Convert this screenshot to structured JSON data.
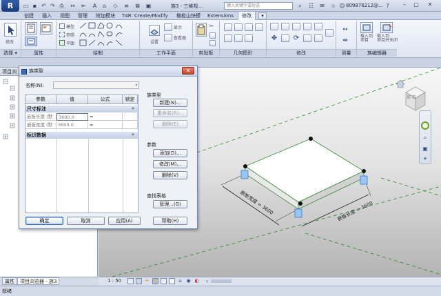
{
  "titlebar": {
    "app_button": "R",
    "window_title": "族3 - 三维视...",
    "search_placeholder": "键入关键字或短语",
    "user": "809876212@...",
    "qat_icons": [
      "open-icon",
      "save-icon",
      "undo-icon",
      "redo-icon",
      "print-icon",
      "measure-icon",
      "dimension-icon",
      "text-icon",
      "3d-view-icon",
      "section-icon",
      "thin-lines-icon",
      "close-hidden-icon",
      "switch-windows-icon"
    ]
  },
  "tabs": [
    "创建",
    "插入",
    "视图",
    "管理",
    "附加模块",
    "T4R: Create/Modify",
    "橄榄山快模",
    "Extensions",
    "修改"
  ],
  "active_tab": "修改",
  "ribbon": {
    "select_label": "选择 ▾",
    "properties_label": "属性",
    "draw_label": "绘制",
    "workplane_label": "工作平面",
    "clipboard_label": "剪贴板",
    "geometry_label": "几何图形",
    "modify_label": "修改",
    "measure_label": "测量",
    "family_editor_label": "族编辑器",
    "tool_modify": "修改",
    "tool_model": "模型",
    "tool_ref": "参照",
    "tool_plane": "平面",
    "tool_set": "设置",
    "tool_show": "显示",
    "tool_viewer": "查看器",
    "tool_load_project": "载入到\n项目",
    "tool_load_close": "载入到\n项目并关闭"
  },
  "left_panel": {
    "header": "项目浏",
    "tab_properties": "属性",
    "tab_browser": "项目浏览器 - 族3"
  },
  "dialog": {
    "title": "族类型",
    "name_label": "名称(N):",
    "name_value": "",
    "col_param": "参数",
    "col_value": "值",
    "col_formula": "公式",
    "col_lock": "锁定",
    "group1": "尺寸标注",
    "group2": "标识数据",
    "rows": [
      {
        "param": "嵌板长度 (默",
        "value": "3600.0",
        "formula": "="
      },
      {
        "param": "嵌板宽度 (默",
        "value": "3600.0",
        "formula": "="
      }
    ],
    "family_types_label": "族类型",
    "btn_new": "新建(N)...",
    "btn_rename": "重命名(R)...",
    "btn_delete_type": "删除(E)",
    "params_label": "参数",
    "btn_add": "添加(D)...",
    "btn_modify": "修改(M)...",
    "btn_delete_param": "删除(V)",
    "lookup_label": "查找表格",
    "btn_manage": "管理...(G)",
    "btn_ok": "确定",
    "btn_cancel": "取消",
    "btn_apply": "应用(A)",
    "btn_help": "帮助(H)"
  },
  "viewport": {
    "dim_width": "嵌板宽度 = 3600",
    "dim_length": "嵌板长度 = 3600",
    "viewcube_label": "前 右"
  },
  "view_control_bar": {
    "scale": "1 : 50"
  },
  "status_bar": {
    "text": "就绪"
  },
  "colors": {
    "ribbon_bg": "#e6ebf4",
    "dialog_bg": "#eef1f6",
    "panel_edge": "#2a8a2a",
    "group_header": "#c3cfe5"
  }
}
